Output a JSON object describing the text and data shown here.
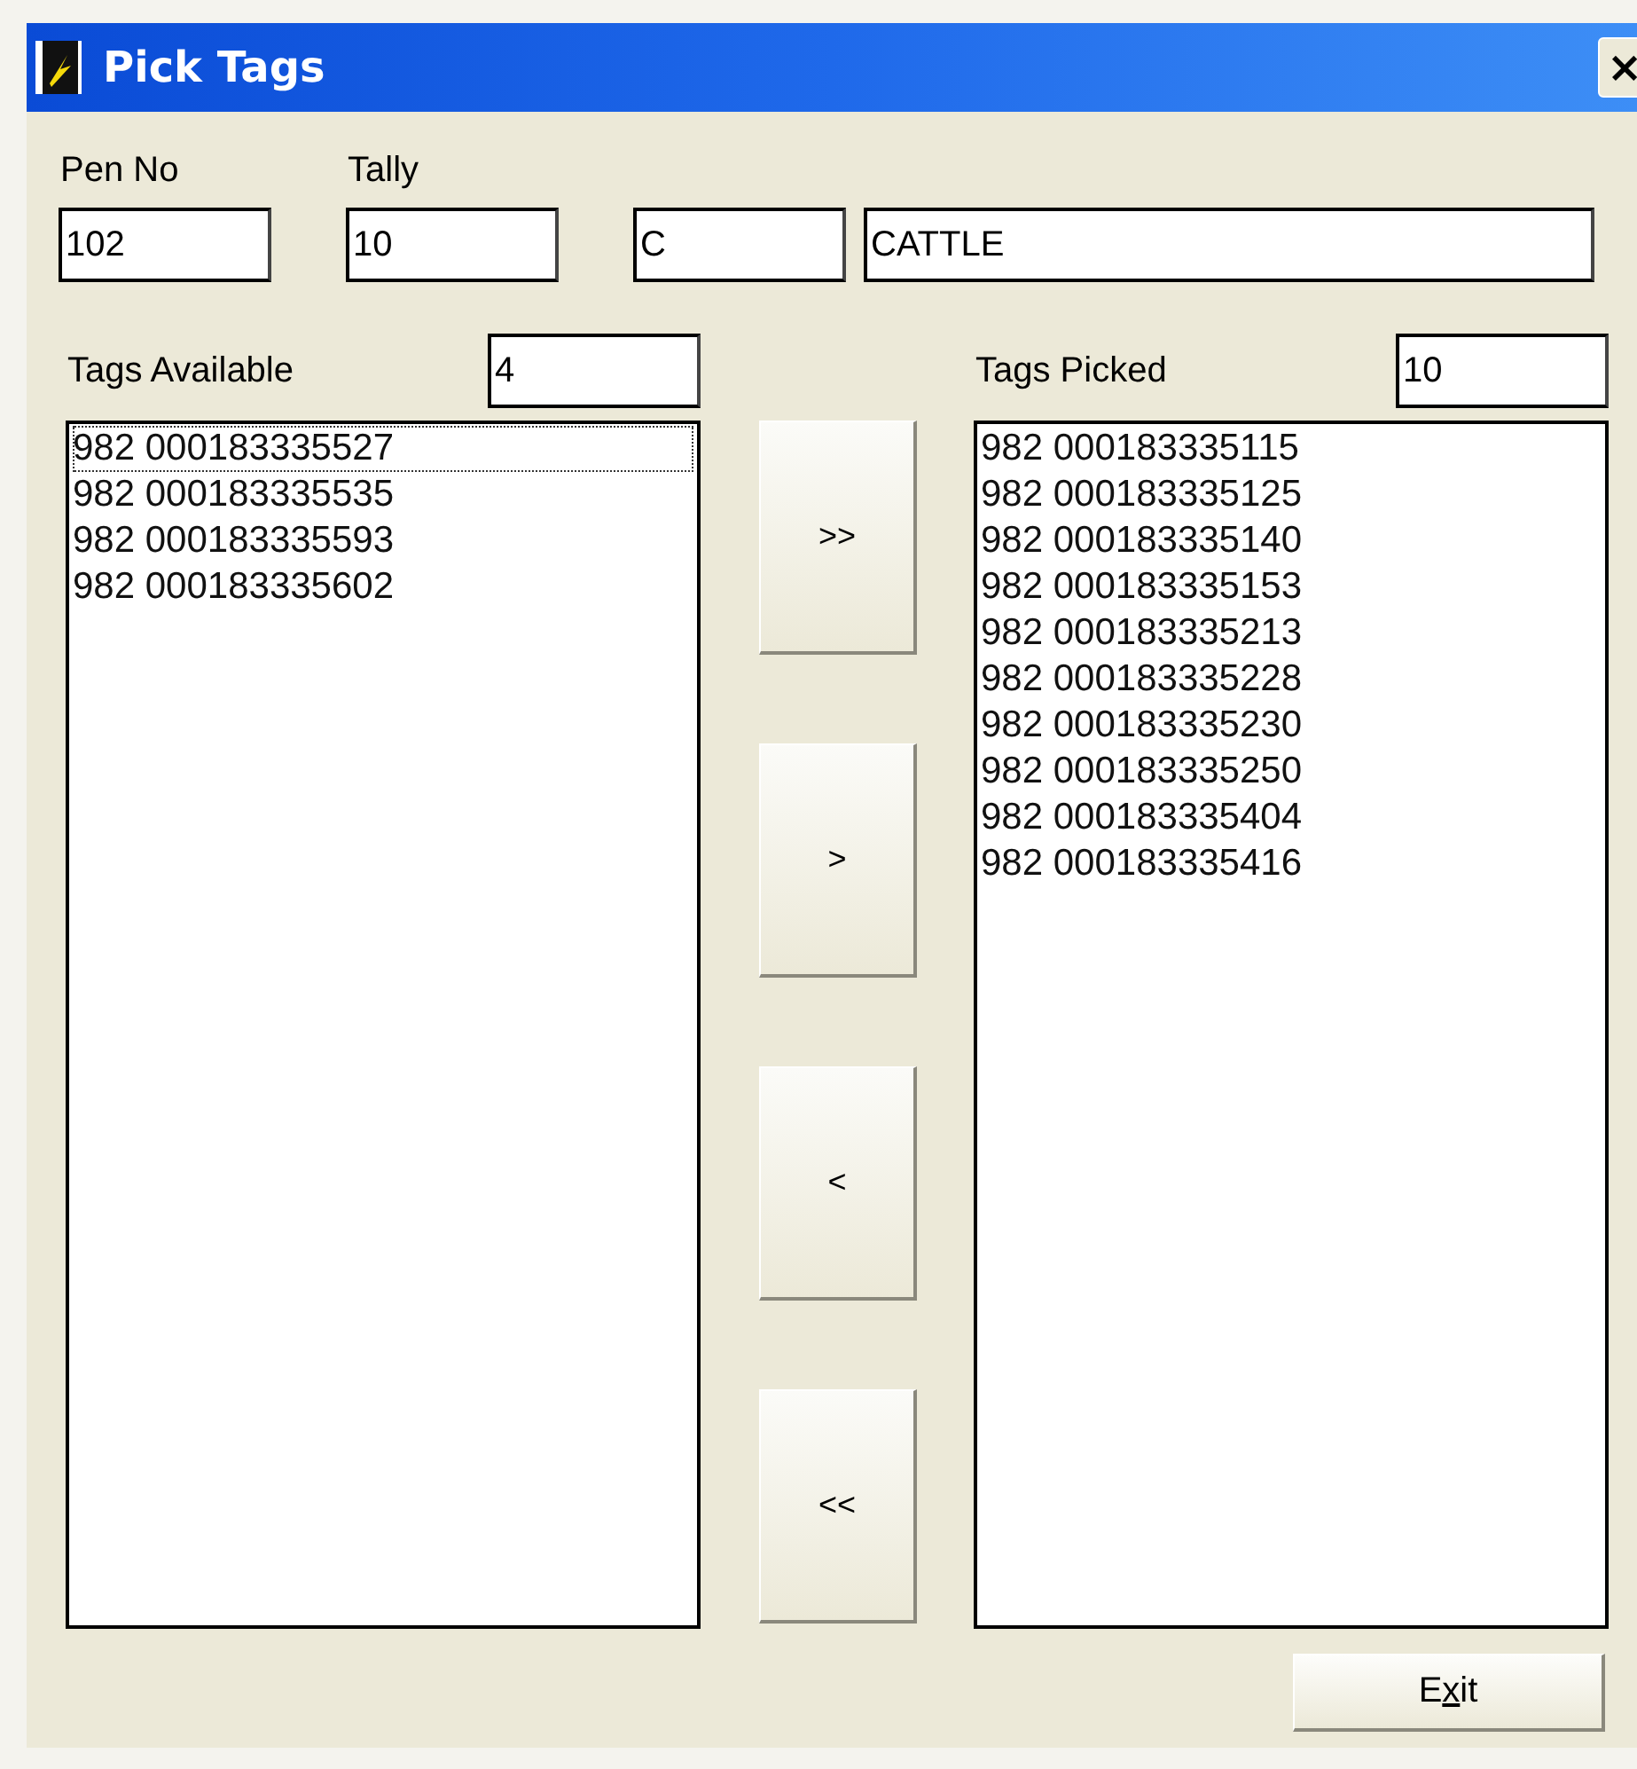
{
  "window": {
    "title": "Pick Tags",
    "close_label": "×"
  },
  "header": {
    "fields": [
      {
        "label": "Pen No",
        "value": "102",
        "kind": "short"
      },
      {
        "label": "Tally",
        "value": "10",
        "kind": "short"
      },
      {
        "value": "C",
        "kind": "short"
      },
      {
        "value": "CATTLE",
        "kind": "wide"
      }
    ]
  },
  "available": {
    "label": "Tags Available",
    "count": "4",
    "items": [
      {
        "text": "982 000183335527",
        "focused": true
      },
      {
        "text": "982 000183335535",
        "focused": false
      },
      {
        "text": "982 000183335593",
        "focused": false
      },
      {
        "text": "982 000183335602",
        "focused": false
      }
    ]
  },
  "move_buttons": [
    ">>",
    ">",
    "<",
    "<<"
  ],
  "picked": {
    "label": "Tags Picked",
    "count": "10",
    "items": [
      {
        "text": "982 000183335115",
        "focused": false
      },
      {
        "text": "982 000183335125",
        "focused": false
      },
      {
        "text": "982 000183335140",
        "focused": false
      },
      {
        "text": "982 000183335153",
        "focused": false
      },
      {
        "text": "982 000183335213",
        "focused": false
      },
      {
        "text": "982 000183335228",
        "focused": false
      },
      {
        "text": "982 000183335230",
        "focused": false
      },
      {
        "text": "982 000183335250",
        "focused": false
      },
      {
        "text": "982 000183335404",
        "focused": false
      },
      {
        "text": "982 000183335416",
        "focused": false
      }
    ]
  },
  "exit_button": {
    "before": "E",
    "access_key": "x",
    "after": "it"
  }
}
